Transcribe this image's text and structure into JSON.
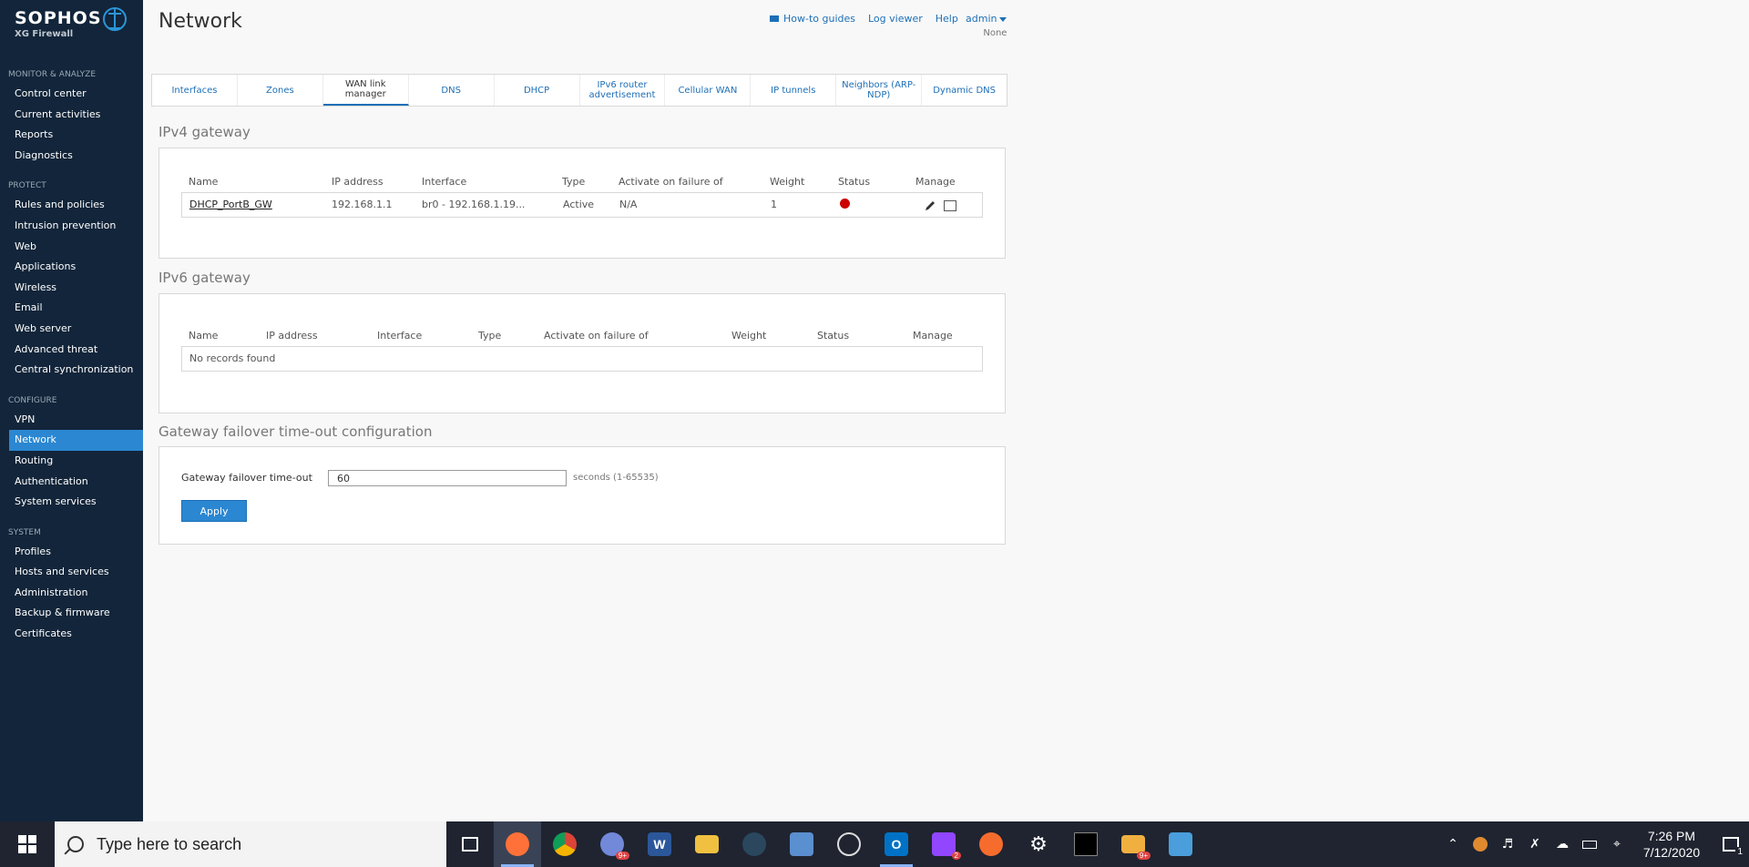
{
  "brand": {
    "name": "SOPHOS",
    "product": "XG Firewall"
  },
  "sidebar": {
    "sections": [
      {
        "title": "MONITOR & ANALYZE",
        "items": [
          "Control center",
          "Current activities",
          "Reports",
          "Diagnostics"
        ]
      },
      {
        "title": "PROTECT",
        "items": [
          "Rules and policies",
          "Intrusion prevention",
          "Web",
          "Applications",
          "Wireless",
          "Email",
          "Web server",
          "Advanced threat",
          "Central synchronization"
        ]
      },
      {
        "title": "CONFIGURE",
        "items": [
          "VPN",
          "Network",
          "Routing",
          "Authentication",
          "System services"
        ]
      },
      {
        "title": "SYSTEM",
        "items": [
          "Profiles",
          "Hosts and services",
          "Administration",
          "Backup & firmware",
          "Certificates"
        ]
      }
    ],
    "active": "Network"
  },
  "header": {
    "title": "Network",
    "links": {
      "howto": "How-to guides",
      "log": "Log viewer",
      "help": "Help"
    },
    "user": "admin",
    "user_sub": "None"
  },
  "tabs": [
    {
      "label": "Interfaces"
    },
    {
      "label": "Zones"
    },
    {
      "label": "WAN link manager",
      "active": true
    },
    {
      "label": "DNS"
    },
    {
      "label": "DHCP"
    },
    {
      "label": "IPv6 router advertisement"
    },
    {
      "label": "Cellular WAN"
    },
    {
      "label": "IP tunnels"
    },
    {
      "label": "Neighbors (ARP-NDP)"
    },
    {
      "label": "Dynamic DNS"
    }
  ],
  "ipv4": {
    "title": "IPv4 gateway",
    "columns": {
      "name": "Name",
      "ip": "IP address",
      "iface": "Interface",
      "type": "Type",
      "failover": "Activate on failure of",
      "weight": "Weight",
      "status": "Status",
      "manage": "Manage"
    },
    "row": {
      "name": "DHCP_PortB_GW",
      "ip": "192.168.1.1",
      "iface": "br0 - 192.168.1.19...",
      "type": "Active",
      "failover": "N/A",
      "weight": "1",
      "status_color": "#cc0000"
    }
  },
  "ipv6": {
    "title": "IPv6 gateway",
    "columns": {
      "name": "Name",
      "ip": "IP address",
      "iface": "Interface",
      "type": "Type",
      "failover": "Activate on failure of",
      "weight": "Weight",
      "status": "Status",
      "manage": "Manage"
    },
    "empty": "No records found"
  },
  "failover": {
    "title": "Gateway failover time-out configuration",
    "label": "Gateway failover time-out",
    "value": "60",
    "hint": "seconds (1-65535)",
    "apply": "Apply"
  },
  "taskbar": {
    "search_placeholder": "Type here to search",
    "time": "7:26 PM",
    "date": "7/12/2020",
    "notification_count": "1",
    "badges": {
      "chat": "9+",
      "twitch": "2",
      "folder2": "9+"
    }
  }
}
